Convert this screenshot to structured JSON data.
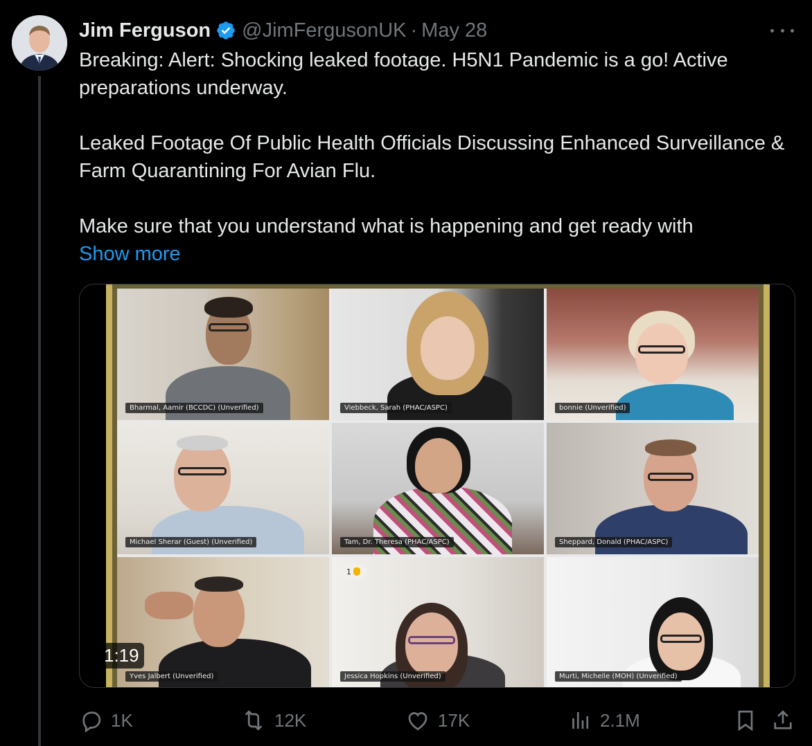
{
  "author": {
    "name": "Jim Ferguson",
    "handle": "@JimFergusonUK",
    "separator": "·",
    "date": "May 28",
    "verified_color": "#1d9bf0"
  },
  "tweet": {
    "paragraphs": [
      "Breaking: Alert: Shocking leaked footage. H5N1 Pandemic is a go! Active preparations underway.",
      "Leaked Footage Of Public Health Officials Discussing Enhanced Surveillance & Farm Quarantining For Avian Flu.",
      "Make sure that you understand what is happening and get ready with"
    ],
    "show_more": "Show more"
  },
  "video": {
    "duration": "1:19",
    "participants": [
      {
        "label": "Bharmal, Aamir (BCCDC) (Unverified)"
      },
      {
        "label": "Viebbeck, Sarah (PHAC/ASPC)"
      },
      {
        "label": "bonnie (Unverified)"
      },
      {
        "label": "Michael Sherar (Guest) (Unverified)"
      },
      {
        "label": "Tam, Dr. Theresa (PHAC/ASPC)"
      },
      {
        "label": "Sheppard, Donald (PHAC/ASPC)"
      },
      {
        "label": "Yves Jalbert (Unverified)"
      },
      {
        "label": "Jessica Hopkins (Unverified)",
        "hand_raised_order": "1"
      },
      {
        "label": "Murti, Michelle (MOH) (Unverified)"
      }
    ]
  },
  "actions": {
    "replies": "1K",
    "reposts": "12K",
    "likes": "17K",
    "views": "2.1M"
  },
  "colors": {
    "background": "#000000",
    "text": "#e7e9ea",
    "muted": "#71767b",
    "link": "#1d9bf0"
  }
}
